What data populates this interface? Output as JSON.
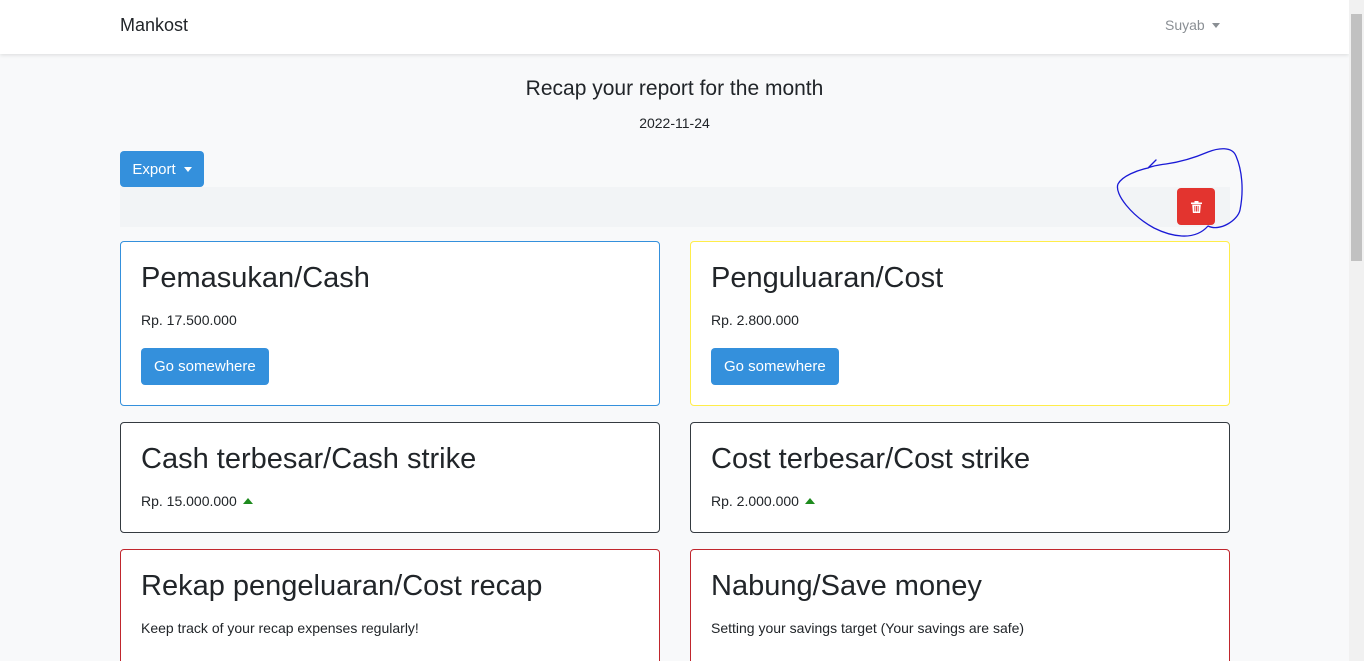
{
  "navbar": {
    "brand": "Mankost",
    "user_name": "Suyab"
  },
  "header": {
    "title": "Recap your report for the month",
    "date": "2022-11-24"
  },
  "toolbar": {
    "export_label": "Export"
  },
  "cards": {
    "cash": {
      "title": "Pemasukan/Cash",
      "amount": "Rp. 17.500.000",
      "button_label": "Go somewhere"
    },
    "cost": {
      "title": "Penguluaran/Cost",
      "amount": "Rp. 2.800.000",
      "button_label": "Go somewhere"
    },
    "cash_strike": {
      "title": "Cash terbesar/Cash strike",
      "amount": "Rp. 15.000.000"
    },
    "cost_strike": {
      "title": "Cost terbesar/Cost strike",
      "amount": "Rp. 2.000.000"
    },
    "cost_recap": {
      "title": "Rekap pengeluaran/Cost recap",
      "text": "Keep track of your recap expenses regularly!"
    },
    "save_money": {
      "title": "Nabung/Save money",
      "text": "Setting your savings target (Your savings are safe)"
    }
  },
  "colors": {
    "primary": "#3490dc",
    "danger": "#e3342f",
    "warning": "#ffed4a",
    "success_arrow": "#1e8b1e",
    "annotation": "#1a1ad6"
  },
  "icons": {
    "delete": "trash-icon",
    "trend": "arrow-up-icon"
  }
}
